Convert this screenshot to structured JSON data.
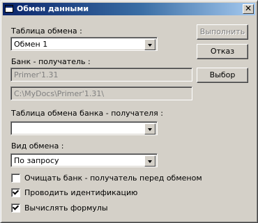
{
  "window": {
    "title": "Обмен данными",
    "close_glyph": "✕"
  },
  "exchange_table": {
    "label": "Таблица обмена :",
    "value": "Обмен 1"
  },
  "receiver_bank": {
    "label": "Банк - получатель :",
    "name": "Primer'1.31",
    "path": "C:\\MyDocs\\Primer'1.31\\"
  },
  "receiver_table": {
    "label": "Таблица обмена банка - получателя :",
    "value": ""
  },
  "exchange_type": {
    "label": "Вид обмена :",
    "value": "По запросу"
  },
  "buttons": {
    "execute": "Выполнить",
    "cancel": "Отказ",
    "select": "Выбор"
  },
  "options": [
    {
      "label": "Очищать банк - получатель перед обменом",
      "checked": false
    },
    {
      "label": "Проводить идентификацию",
      "checked": true
    },
    {
      "label": "Вычислять формулы",
      "checked": true
    }
  ]
}
